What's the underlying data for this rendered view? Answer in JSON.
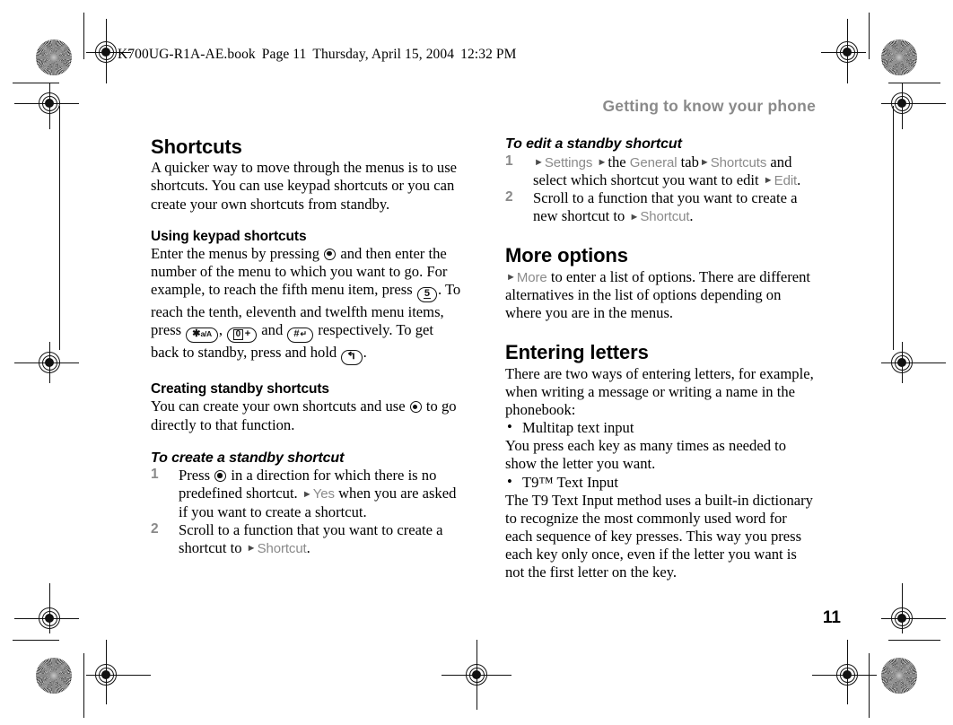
{
  "file_banner": {
    "filename": "K700UG-R1A-AE.book",
    "page_label": "Page 11",
    "date": "Thursday, April 15, 2004",
    "time": "12:32 PM"
  },
  "running_header": "Getting to know your phone",
  "folio": "11",
  "colors": {
    "menu_gray": "#8a8a8a",
    "header_gray": "#8a8a8a",
    "text_black": "#000000"
  },
  "left_column": {
    "section_title": "Shortcuts",
    "intro": "A quicker way to move through the menus is to use shortcuts. You can use keypad shortcuts or you can create your own shortcuts from standby.",
    "keypad": {
      "heading": "Using keypad shortcuts",
      "text_1": "Enter the menus by pressing",
      "text_2": "and then enter the number of the menu to which you want to go. For example, to reach the fifth menu item, press",
      "text_3": ". To reach the tenth, eleventh and twelfth menu items, press",
      "text_4": ",",
      "text_5": "and",
      "text_6": "respectively. To get back to standby, press and hold",
      "text_7": ".",
      "keys": {
        "five": "5",
        "star": "a/A",
        "star_symbol": "✱",
        "zero": "0",
        "zero_plus": "+",
        "hash": "#",
        "hash_return": "↵",
        "back": "↰"
      }
    },
    "creating": {
      "heading": "Creating standby shortcuts",
      "text_1": "You can create your own shortcuts and use",
      "text_2": "to go directly to that function."
    },
    "create_procedure": {
      "heading": "To create a standby shortcut",
      "steps": [
        {
          "num": "1",
          "part_1": "Press",
          "part_2": "in a direction for which there is no predefined shortcut.",
          "menu_1": "Yes",
          "part_3": "when you are asked if you want to create a shortcut."
        },
        {
          "num": "2",
          "part_1": "Scroll to a function that you want to create a shortcut to",
          "menu_1": "Shortcut",
          "part_2": "."
        }
      ]
    }
  },
  "right_column": {
    "edit_procedure": {
      "heading": "To edit a standby shortcut",
      "steps": [
        {
          "num": "1",
          "menu_1": "Settings",
          "mid_1": "the",
          "menu_2": "General",
          "mid_2": "tab",
          "menu_3": "Shortcuts",
          "mid_3": "and select which shortcut you want to edit",
          "menu_4": "Edit",
          "tail": "."
        },
        {
          "num": "2",
          "part_1": "Scroll to a function that you want to create a new shortcut to",
          "menu_1": "Shortcut",
          "part_2": "."
        }
      ]
    },
    "more_options": {
      "heading": "More options",
      "menu_1": "More",
      "text_1": "to enter a list of options. There are different alternatives in the list of options depending on where you are in the menus."
    },
    "entering_letters": {
      "heading": "Entering letters",
      "intro": "There are two ways of entering letters, for example, when writing a message or writing a name in the phonebook:",
      "bullet_1": "Multitap text input",
      "body_1": "You press each key as many times as needed to show the letter you want.",
      "bullet_2": "T9™ Text Input",
      "body_2": "The T9 Text Input method uses a built-in dictionary to recognize the most commonly used word for each sequence of key presses. This way you press each key only once, even if the letter you want is not the first letter on the key."
    }
  },
  "arrow_glyph": "►",
  "bullet_glyph": "•"
}
